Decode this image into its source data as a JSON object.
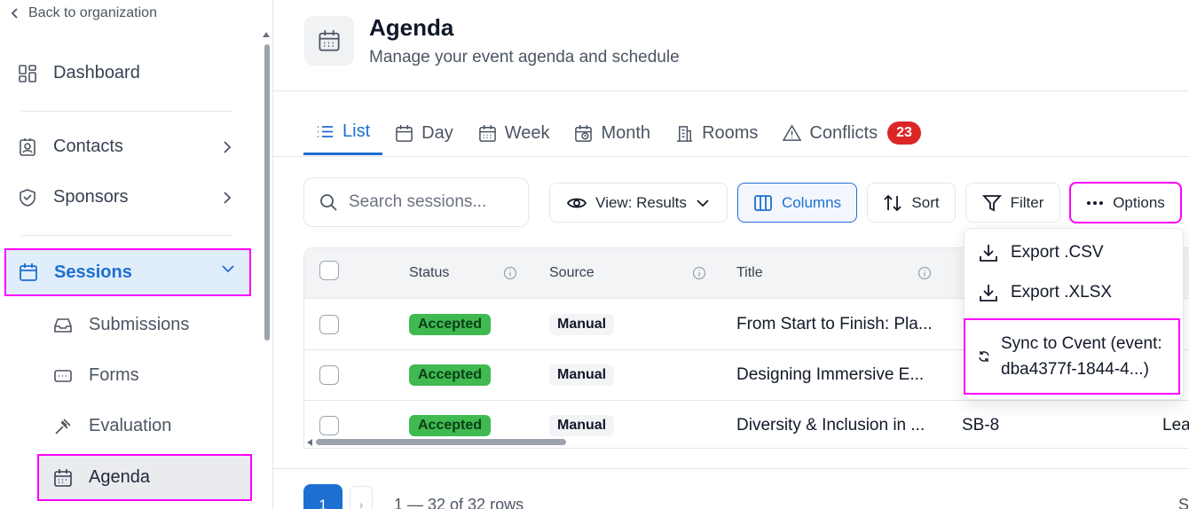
{
  "sidebar": {
    "back_label": "Back to organization",
    "items": [
      {
        "label": "Dashboard",
        "icon": "dashboard-icon"
      },
      {
        "label": "Contacts",
        "icon": "contacts-icon"
      },
      {
        "label": "Sponsors",
        "icon": "sponsors-icon"
      },
      {
        "label": "Sessions",
        "icon": "calendar-icon"
      }
    ],
    "sub_items": [
      {
        "label": "Submissions",
        "icon": "inbox-icon"
      },
      {
        "label": "Forms",
        "icon": "form-icon"
      },
      {
        "label": "Evaluation",
        "icon": "gavel-icon"
      },
      {
        "label": "Agenda",
        "icon": "calendar-icon"
      }
    ]
  },
  "header": {
    "title": "Agenda",
    "subtitle": "Manage your event agenda and schedule"
  },
  "tabs": [
    {
      "label": "List",
      "icon": "list-icon"
    },
    {
      "label": "Day",
      "icon": "calendar-day-icon"
    },
    {
      "label": "Week",
      "icon": "calendar-week-icon"
    },
    {
      "label": "Month",
      "icon": "calendar-month-icon"
    },
    {
      "label": "Rooms",
      "icon": "building-icon"
    },
    {
      "label": "Conflicts",
      "icon": "warning-icon",
      "badge": "23"
    }
  ],
  "toolbar": {
    "search_placeholder": "Search sessions...",
    "view_label": "View: Results",
    "columns_label": "Columns",
    "sort_label": "Sort",
    "filter_label": "Filter",
    "options_label": "Options"
  },
  "table": {
    "headers": {
      "status": "Status",
      "source": "Source",
      "title": "Title"
    },
    "rows": [
      {
        "status": "Accepted",
        "source": "Manual",
        "title": "From Start to Finish: Pla...",
        "room": "",
        "extra": ""
      },
      {
        "status": "Accepted",
        "source": "Manual",
        "title": "Designing Immersive E...",
        "room": "",
        "extra": ""
      },
      {
        "status": "Accepted",
        "source": "Manual",
        "title": "Diversity & Inclusion in ...",
        "room": "SB-8",
        "extra": "Lea"
      }
    ]
  },
  "dropdown": {
    "export_csv": "Export .CSV",
    "export_xlsx": "Export .XLSX",
    "sync_line1": "Sync to Cvent (event:",
    "sync_line2": "dba4377f-1844-4...)"
  },
  "pagination": {
    "current_page": "1",
    "next": "›",
    "rows_info": "1 — 32 of 32 rows",
    "right_text": "S"
  },
  "colors": {
    "accent": "#1d6fd1",
    "highlight": "#ff00ff",
    "accepted": "#3fb950",
    "badge": "#dc2626"
  }
}
